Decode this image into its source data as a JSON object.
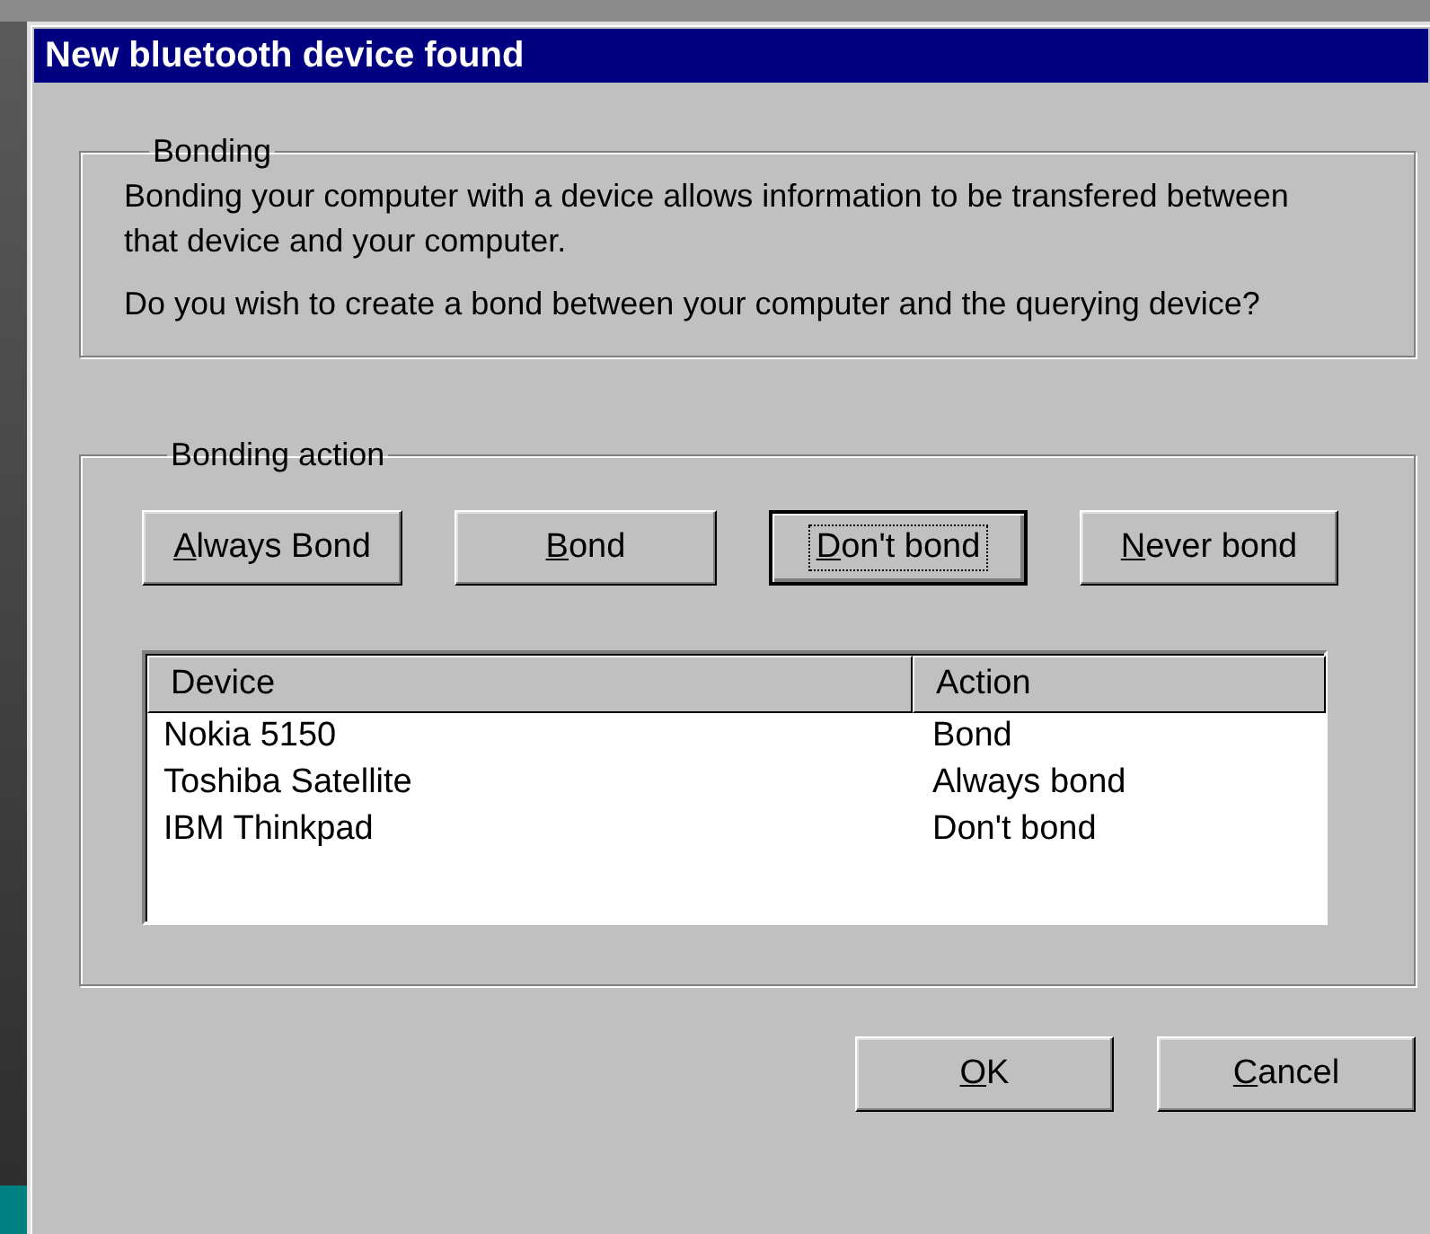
{
  "window": {
    "title": "New bluetooth device found"
  },
  "bonding": {
    "title": "Bonding",
    "paragraphs": [
      "Bonding your computer with a device allows information to be transfered between that device and your computer.",
      "Do you wish to create a bond between your computer and the querying device?"
    ]
  },
  "bonding_action": {
    "title": "Bonding action",
    "buttons": [
      {
        "label": "Always Bond",
        "focused": false
      },
      {
        "label": "Bond",
        "focused": false
      },
      {
        "label": "Don't bond",
        "focused": true
      },
      {
        "label": "Never bond",
        "focused": false
      }
    ],
    "table": {
      "columns": [
        "Device",
        "Action"
      ],
      "rows": [
        [
          "Nokia 5150",
          "Bond"
        ],
        [
          "Toshiba Satellite",
          "Always bond"
        ],
        [
          "IBM Thinkpad",
          "Don't bond"
        ]
      ]
    }
  },
  "buttons": [
    {
      "label": "OK",
      "focused": false
    },
    {
      "label": "Cancel",
      "focused": false
    }
  ]
}
